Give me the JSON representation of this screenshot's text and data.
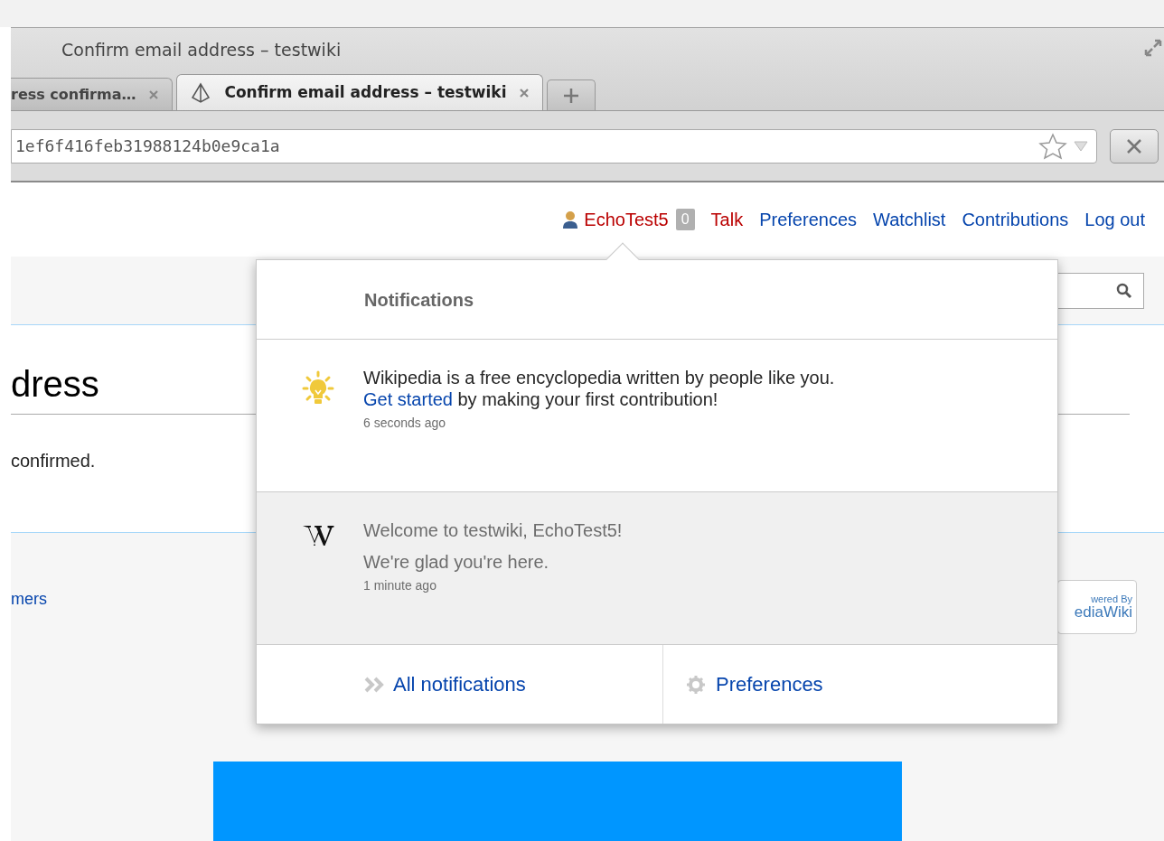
{
  "window": {
    "title": "Confirm email address – testwiki"
  },
  "tabs": [
    {
      "label": "ress confirma…",
      "selected": false
    },
    {
      "label": "Confirm email address – testwiki",
      "selected": true
    }
  ],
  "address_bar": {
    "url": "1ef6f416feb31988124b0e9ca1a"
  },
  "user_menu": {
    "username": "EchoTest5",
    "badge": "0",
    "links": [
      {
        "label": "Talk",
        "kind": "redlink"
      },
      {
        "label": "Preferences",
        "kind": "link"
      },
      {
        "label": "Watchlist",
        "kind": "link"
      },
      {
        "label": "Contributions",
        "kind": "link"
      },
      {
        "label": "Log out",
        "kind": "link"
      }
    ]
  },
  "page": {
    "heading": "dress",
    "message": "confirmed.",
    "footer_link": "mers",
    "powered_badge": [
      "wered By",
      "ediaWiki"
    ]
  },
  "notifications": {
    "title": "Notifications",
    "items": [
      {
        "kind": "tip",
        "unread": true,
        "title": "Wikipedia is a free encyclopedia written by people like you.",
        "link": "Get started",
        "body": "by making your first contribution!",
        "time": "6 seconds ago"
      },
      {
        "kind": "welcome",
        "unread": false,
        "title": "Welcome to testwiki, EchoTest5!",
        "body": "We're glad you're here.",
        "time": "1 minute ago"
      }
    ],
    "footer": {
      "all": "All notifications",
      "preferences": "Preferences"
    }
  }
}
